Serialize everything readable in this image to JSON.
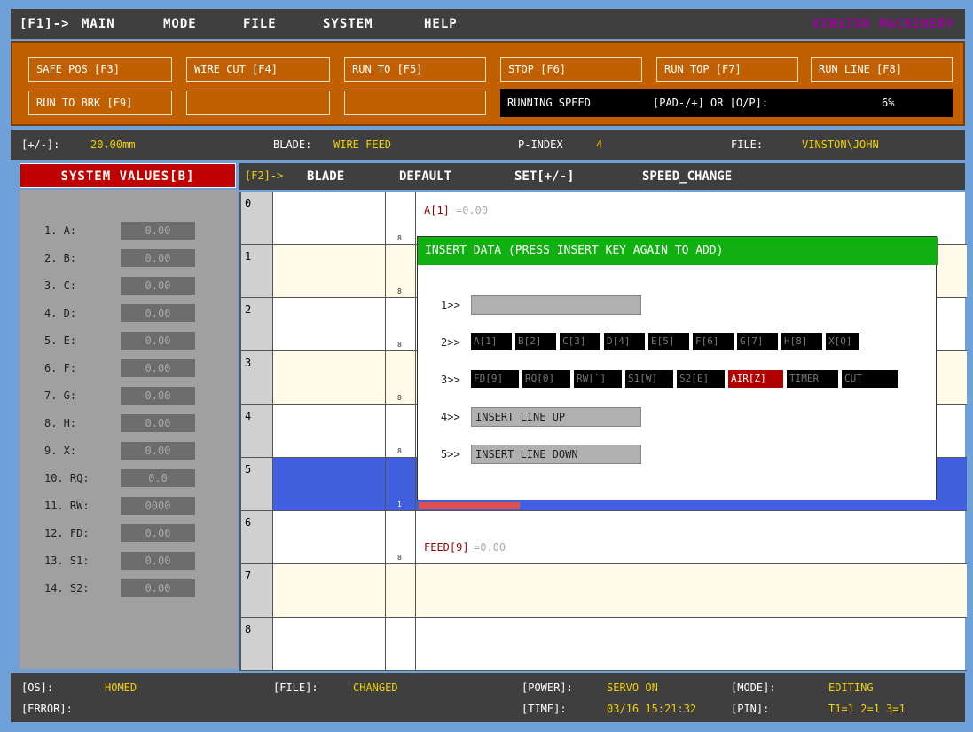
{
  "menu": {
    "f1_label": "[F1]->",
    "items": [
      "MAIN",
      "MODE",
      "FILE",
      "SYSTEM",
      "HELP"
    ],
    "brand": "VINSTON MACHINERY"
  },
  "toolbar": {
    "buttons": [
      "SAFE POS [F3]",
      "WIRE CUT [F4]",
      "RUN TO [F5]",
      "STOP [F6]",
      "RUN TOP [F7]",
      "RUN LINE [F8]",
      "RUN TO BRK [F9]",
      "",
      ""
    ],
    "speed_label": "RUNNING SPEED",
    "speed_hint": "[PAD-/+] OR [O/P]:",
    "speed_value": "6%"
  },
  "status": {
    "step_label": "[+/-]:",
    "step_value": "20.00mm",
    "blade_label": "BLADE:",
    "blade_value": "WIRE FEED",
    "pindex_label": "P-INDEX",
    "pindex_value": "4",
    "file_label": "FILE:",
    "file_value": "VINSTON\\JOHN"
  },
  "system_values": {
    "title": "SYSTEM VALUES[B]",
    "rows": [
      {
        "label": "1. A:",
        "value": "0.00"
      },
      {
        "label": "2. B:",
        "value": "0.00"
      },
      {
        "label": "3. C:",
        "value": "0.00"
      },
      {
        "label": "4. D:",
        "value": "0.00"
      },
      {
        "label": "5. E:",
        "value": "0.00"
      },
      {
        "label": "6. F:",
        "value": "0.00"
      },
      {
        "label": "7. G:",
        "value": "0.00"
      },
      {
        "label": "8. H:",
        "value": "0.00"
      },
      {
        "label": "9. X:",
        "value": "0.00"
      },
      {
        "label": "10. RQ:",
        "value": "0.0"
      },
      {
        "label": "11. RW:",
        "value": "0000"
      },
      {
        "label": "12. FD:",
        "value": "0.00"
      },
      {
        "label": "13. S1:",
        "value": "0.00"
      },
      {
        "label": "14. S2:",
        "value": "0.00"
      }
    ]
  },
  "grid_header": {
    "f2_label": "[F2]->",
    "items": [
      "BLADE",
      "DEFAULT",
      "SET[+/-]",
      "SPEED_CHANGE"
    ]
  },
  "grid": {
    "rows": [
      "0",
      "1",
      "2",
      "3",
      "4",
      "5",
      "6",
      "7",
      "8"
    ],
    "small": [
      "8",
      "8",
      "8",
      "8",
      "8",
      "1",
      "8"
    ],
    "line0_code": "A[1]",
    "line0_value": "=0.00",
    "line6_code": "FEED[9]",
    "line6_value": "=0.00"
  },
  "popup": {
    "title": "INSERT DATA (PRESS INSERT KEY AGAIN TO ADD)",
    "labels": [
      "1>>",
      "2>>",
      "3>>",
      "4>>",
      "5>>"
    ],
    "row2": [
      "A[1]",
      "B[2]",
      "C[3]",
      "D[4]",
      "E[5]",
      "F[6]",
      "G[7]",
      "H[8]",
      "X[Q]"
    ],
    "row3": [
      "FD[9]",
      "RQ[0]",
      "RW[`]",
      "S1[W]",
      "S2[E]",
      "AIR[Z]",
      "TIMER",
      "CUT"
    ],
    "insert_up": "INSERT LINE UP",
    "insert_down": "INSERT LINE DOWN"
  },
  "bottom": {
    "os_label": "[OS]:",
    "os_value": "HOMED",
    "file_label": "[FILE]:",
    "file_value": "CHANGED",
    "power_label": "[POWER]:",
    "power_value": "SERVO ON",
    "mode_label": "[MODE]:",
    "mode_value": "EDITING",
    "error_label": "[ERROR]:",
    "time_label": "[TIME]:",
    "time_value": "03/16 15:21:32",
    "pin_label": "[PIN]:",
    "pin_value": "T1=1 2=1 3=1"
  }
}
